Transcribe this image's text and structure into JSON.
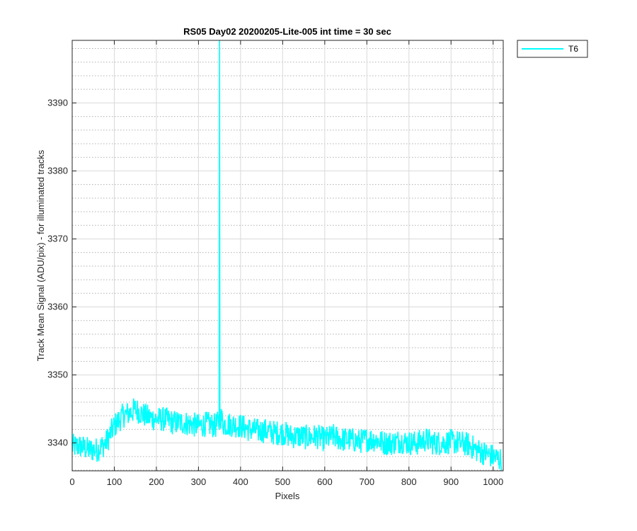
{
  "chart_data": {
    "type": "line",
    "title": "RS05 Day02 20200205-Lite-005 int time = 30 sec",
    "xlabel": "Pixels",
    "ylabel": "Track Mean Signal (ADU/pix) - for illuminated tracks",
    "xlim": [
      0,
      1024
    ],
    "ylim": [
      3335.9,
      3399.2
    ],
    "xticks": [
      0,
      100,
      200,
      300,
      400,
      500,
      600,
      700,
      800,
      900,
      1000
    ],
    "yticks": [
      3340,
      3350,
      3360,
      3370,
      3380,
      3390
    ],
    "y_minor_step": 2,
    "grid": true,
    "legend_position": "outside-top-right",
    "series": [
      {
        "name": "T6",
        "color": "#00ffff",
        "x": [
          0,
          20,
          40,
          60,
          80,
          100,
          120,
          140,
          150,
          160,
          180,
          200,
          220,
          240,
          260,
          280,
          300,
          320,
          340,
          348,
          350,
          352,
          360,
          380,
          400,
          420,
          440,
          460,
          480,
          500,
          520,
          540,
          560,
          580,
          600,
          620,
          640,
          660,
          680,
          700,
          720,
          740,
          760,
          780,
          800,
          820,
          840,
          860,
          880,
          900,
          920,
          940,
          960,
          980,
          1000,
          1020
        ],
        "y": [
          3339.5,
          3339.5,
          3339.0,
          3339.0,
          3340.0,
          3342.5,
          3344.0,
          3344.5,
          3345.0,
          3344.5,
          3343.8,
          3343.5,
          3343.5,
          3343.0,
          3343.0,
          3342.8,
          3342.5,
          3342.8,
          3342.5,
          3343.0,
          3399.2,
          3344.0,
          3342.8,
          3342.7,
          3342.5,
          3342.0,
          3341.8,
          3341.8,
          3341.5,
          3341.5,
          3341.0,
          3341.0,
          3340.8,
          3341.0,
          3340.5,
          3341.0,
          3340.5,
          3340.5,
          3340.2,
          3340.5,
          3340.5,
          3340.0,
          3340.0,
          3340.3,
          3340.0,
          3340.0,
          3340.5,
          3340.0,
          3340.0,
          3340.2,
          3340.0,
          3339.8,
          3339.0,
          3338.5,
          3338.0,
          3337.5
        ],
        "noise_amplitude": 1.8
      }
    ]
  }
}
